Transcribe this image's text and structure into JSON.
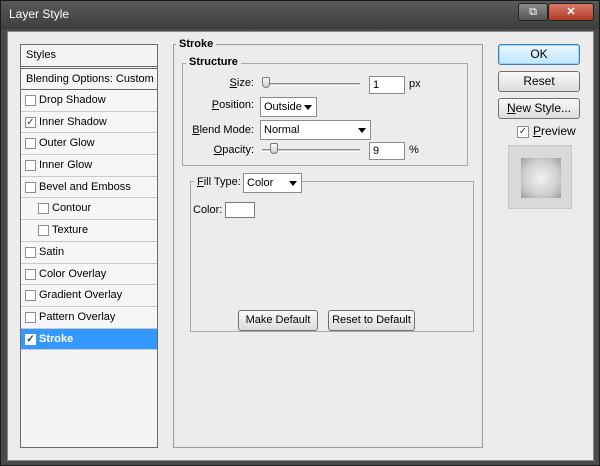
{
  "window": {
    "title": "Layer Style",
    "restore_glyph": "⧉",
    "close_glyph": "✕"
  },
  "styles_panel": {
    "header": "Styles",
    "blending_options": "Blending Options: Custom",
    "items": [
      {
        "label": "Drop Shadow",
        "checked": false
      },
      {
        "label": "Inner Shadow",
        "checked": true
      },
      {
        "label": "Outer Glow",
        "checked": false
      },
      {
        "label": "Inner Glow",
        "checked": false
      },
      {
        "label": "Bevel and Emboss",
        "checked": false
      },
      {
        "label": "Contour",
        "checked": false,
        "sub": true
      },
      {
        "label": "Texture",
        "checked": false,
        "sub": true
      },
      {
        "label": "Satin",
        "checked": false
      },
      {
        "label": "Color Overlay",
        "checked": false
      },
      {
        "label": "Gradient Overlay",
        "checked": false
      },
      {
        "label": "Pattern Overlay",
        "checked": false
      },
      {
        "label": "Stroke",
        "checked": true,
        "selected": true
      }
    ]
  },
  "stroke": {
    "title": "Stroke",
    "structure": {
      "title": "Structure",
      "size_label": "Size:",
      "size_value": "1",
      "size_unit": "px",
      "position_label": "Position:",
      "position_value": "Outside",
      "blend_mode_label": "Blend Mode:",
      "blend_mode_value": "Normal",
      "opacity_label": "Opacity:",
      "opacity_value": "9",
      "opacity_unit": "%"
    },
    "fill_type_label": "Fill Type:",
    "fill_type_value": "Color",
    "color_label": "Color:",
    "color_value": "#ffffff",
    "make_default": "Make Default",
    "reset_to_default": "Reset to Default"
  },
  "actions": {
    "ok": "OK",
    "reset": "Reset",
    "new_style": "New Style...",
    "preview_label": "Preview",
    "preview_checked": true
  },
  "colors": {
    "selection": "#3399ff",
    "dialog_bg": "#ececec"
  }
}
